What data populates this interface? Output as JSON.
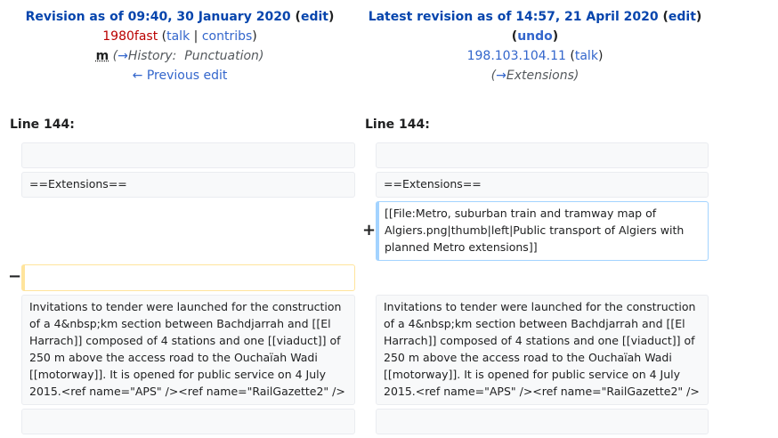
{
  "left": {
    "title_prefix": "Revision as of 09:40, 30 January 2020",
    "edit_label": "edit",
    "user": "1980fast",
    "talk_label": "talk",
    "separator": "|",
    "contribs_label": "contribs",
    "minor_flag": "m",
    "summary_arrow": "→",
    "summary_section": "History:",
    "summary_text": "Punctuation",
    "prev_edit": "← Previous edit",
    "line_label": "Line 144:"
  },
  "right": {
    "title_prefix": "Latest revision as of 14:57, 21 April 2020",
    "edit_label": "edit",
    "undo_label": "undo",
    "user": "198.103.104.11",
    "talk_label": "talk",
    "summary_arrow": "→",
    "summary_section": "Extensions",
    "line_label": "Line 144:"
  },
  "diff": {
    "heading": "==Extensions==",
    "added_line": "[[File:Metro, suburban train and tramway map of Algiers.png|thumb|left|Public transport of Algiers with planned Metro extensions]]",
    "paragraph": "Invitations to tender were launched for the construction of a 4&nbsp;km section between Bachdjarrah and [[El Harrach]] composed of 4 stations and one [[viaduct]] of 250 m above the access road to the Ouchaïah Wadi [[motorway]]. It is opened for public service on 4 July 2015.<ref name=\"APS\" /><ref name=\"RailGazette2\" />",
    "plus_marker": "+",
    "minus_marker": "−"
  }
}
